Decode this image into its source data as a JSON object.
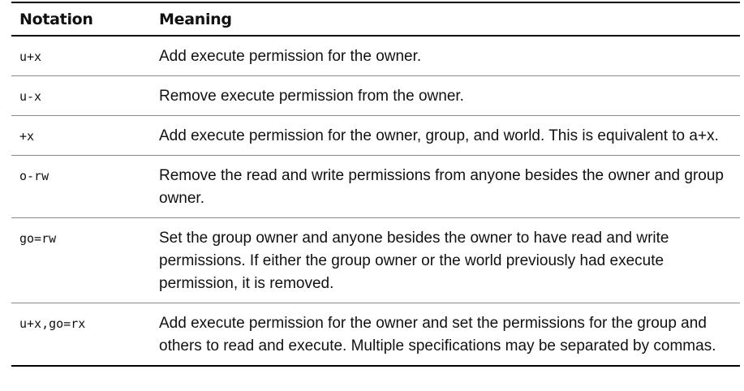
{
  "table": {
    "headers": {
      "notation": "Notation",
      "meaning": "Meaning"
    },
    "rows": [
      {
        "notation": "u+x",
        "meaning": "Add execute permission for the owner."
      },
      {
        "notation": "u-x",
        "meaning": "Remove execute permission from the owner."
      },
      {
        "notation": "+x",
        "meaning": "Add execute permission for the owner, group, and world. This is equivalent to a+x."
      },
      {
        "notation": "o-rw",
        "meaning": "Remove the read and write permissions from anyone besides the owner and group owner."
      },
      {
        "notation": "go=rw",
        "meaning": "Set the group owner and anyone besides the owner to have read and write permissions. If either the group owner or the world previously had execute permission, it is removed."
      },
      {
        "notation": "u+x,go=rx",
        "meaning": "Add execute permission for the owner and set the permissions for the group and others to read and execute. Multiple specifications may be separated by commas."
      }
    ]
  }
}
